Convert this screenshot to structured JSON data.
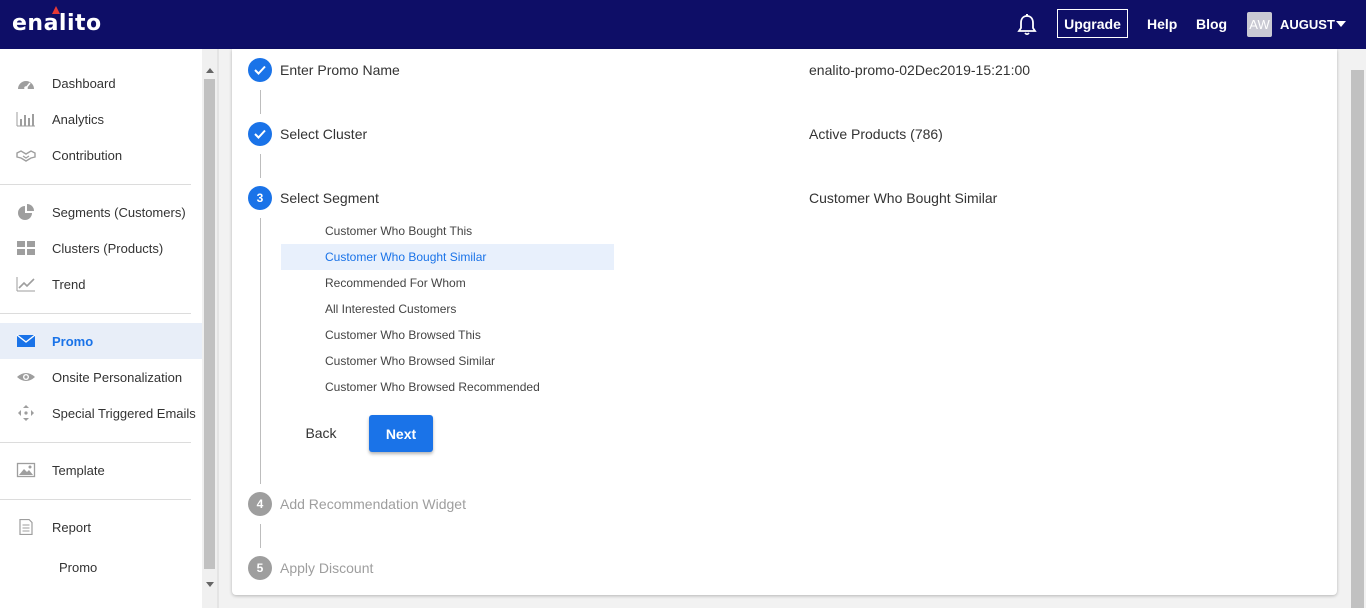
{
  "header": {
    "logo": "enalito",
    "upgrade_label": "Upgrade",
    "help_label": "Help",
    "blog_label": "Blog",
    "avatar_initials": "AW",
    "user_name": "AUGUST"
  },
  "sidebar": {
    "items": [
      {
        "label": "Dashboard",
        "icon": "dashboard-icon"
      },
      {
        "label": "Analytics",
        "icon": "bar-chart-icon"
      },
      {
        "label": "Contribution",
        "icon": "handshake-icon"
      },
      {
        "label": "Segments (Customers)",
        "icon": "pie-chart-icon"
      },
      {
        "label": "Clusters (Products)",
        "icon": "grid-icon"
      },
      {
        "label": "Trend",
        "icon": "trend-icon"
      },
      {
        "label": "Promo",
        "icon": "mail-icon",
        "active": true
      },
      {
        "label": "Onsite Personalization",
        "icon": "eye-icon"
      },
      {
        "label": "Special Triggered Emails",
        "icon": "move-icon"
      },
      {
        "label": "Template",
        "icon": "image-icon"
      },
      {
        "label": "Report",
        "icon": "document-icon"
      }
    ],
    "sub_items": [
      {
        "label": "Promo"
      }
    ]
  },
  "stepper": {
    "steps": [
      {
        "number": "1",
        "title": "Enter Promo Name",
        "value": "enalito-promo-02Dec2019-15:21:00",
        "status": "done"
      },
      {
        "number": "2",
        "title": "Select Cluster",
        "value": "Active Products (786)",
        "status": "done"
      },
      {
        "number": "3",
        "title": "Select Segment",
        "value": "Customer Who Bought Similar",
        "status": "current"
      },
      {
        "number": "4",
        "title": "Add Recommendation Widget",
        "status": "pending"
      },
      {
        "number": "5",
        "title": "Apply Discount",
        "status": "pending"
      }
    ],
    "segment_options": [
      {
        "label": "Customer Who Bought This"
      },
      {
        "label": "Customer Who Bought Similar",
        "selected": true
      },
      {
        "label": "Recommended For Whom"
      },
      {
        "label": "All Interested Customers"
      },
      {
        "label": "Customer Who Browsed This"
      },
      {
        "label": "Customer Who Browsed Similar"
      },
      {
        "label": "Customer Who Browsed Recommended"
      }
    ],
    "back_label": "Back",
    "next_label": "Next"
  },
  "colors": {
    "topbar": "#0e0e67",
    "accent": "#1a73e8",
    "pending": "#9e9e9e",
    "selected_bg": "#e8f0fc"
  }
}
